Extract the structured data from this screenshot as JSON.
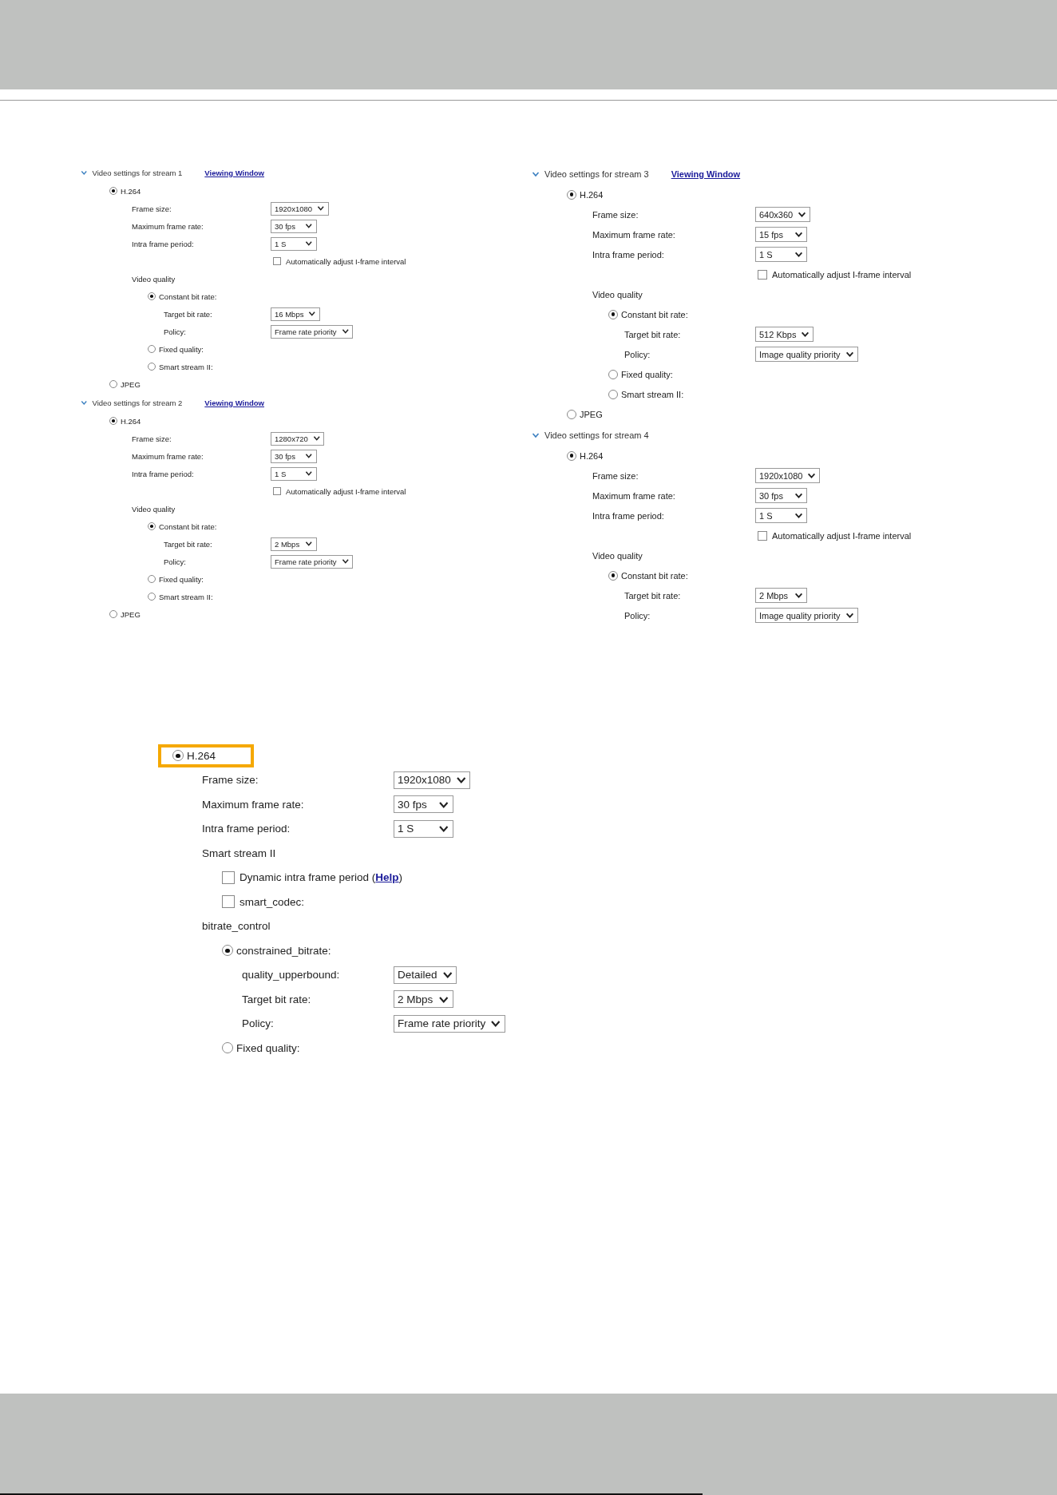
{
  "screenshots": [
    {
      "streams": [
        {
          "title": "Video settings for stream 1",
          "link": "Viewing Window",
          "expanded": true,
          "children": [
            {
              "kind": "radio",
              "label": "H.264",
              "selected": true,
              "children": [
                {
                  "kind": "select",
                  "label": "Frame size:",
                  "value": "1920x1080"
                },
                {
                  "kind": "select",
                  "label": "Maximum frame rate:",
                  "value": "30 fps"
                },
                {
                  "kind": "select",
                  "label": "Intra frame period:",
                  "value": "1 S"
                },
                {
                  "kind": "option",
                  "label": "Automatically adjust I-frame interval",
                  "checked": false
                },
                {
                  "kind": "heading",
                  "label": "Video quality",
                  "children": [
                    {
                      "kind": "radio",
                      "label": "Constant bit rate:",
                      "selected": true,
                      "children": [
                        {
                          "kind": "select",
                          "label": "Target bit rate:",
                          "value": "16 Mbps"
                        },
                        {
                          "kind": "select",
                          "label": "Policy:",
                          "value": "Frame rate priority"
                        }
                      ]
                    },
                    {
                      "kind": "radio",
                      "label": "Fixed quality:",
                      "selected": false
                    },
                    {
                      "kind": "radio",
                      "label": "Smart stream II:",
                      "selected": false
                    }
                  ]
                }
              ]
            },
            {
              "kind": "radio",
              "label": "JPEG",
              "selected": false
            }
          ]
        },
        {
          "title": "Video settings for stream 2",
          "link": "Viewing Window",
          "expanded": true,
          "children": [
            {
              "kind": "radio",
              "label": "H.264",
              "selected": true,
              "children": [
                {
                  "kind": "select",
                  "label": "Frame size:",
                  "value": "1280x720"
                },
                {
                  "kind": "select",
                  "label": "Maximum frame rate:",
                  "value": "30 fps"
                },
                {
                  "kind": "select",
                  "label": "Intra frame period:",
                  "value": "1 S"
                },
                {
                  "kind": "option",
                  "label": "Automatically adjust I-frame interval",
                  "checked": false
                },
                {
                  "kind": "heading",
                  "label": "Video quality",
                  "children": [
                    {
                      "kind": "radio",
                      "label": "Constant bit rate:",
                      "selected": true,
                      "children": [
                        {
                          "kind": "select",
                          "label": "Target bit rate:",
                          "value": "2 Mbps"
                        },
                        {
                          "kind": "select",
                          "label": "Policy:",
                          "value": "Frame rate priority"
                        }
                      ]
                    },
                    {
                      "kind": "radio",
                      "label": "Fixed quality:",
                      "selected": false
                    },
                    {
                      "kind": "radio",
                      "label": "Smart stream II:",
                      "selected": false
                    }
                  ]
                }
              ]
            },
            {
              "kind": "radio",
              "label": "JPEG",
              "selected": false
            }
          ]
        }
      ]
    },
    {
      "streams": [
        {
          "title": "Video settings for stream 3",
          "link": "Viewing Window",
          "expanded": true,
          "children": [
            {
              "kind": "radio",
              "label": "H.264",
              "selected": true,
              "children": [
                {
                  "kind": "select",
                  "label": "Frame size:",
                  "value": "640x360"
                },
                {
                  "kind": "select",
                  "label": "Maximum frame rate:",
                  "value": "15 fps"
                },
                {
                  "kind": "select",
                  "label": "Intra frame period:",
                  "value": "1 S"
                },
                {
                  "kind": "option",
                  "label": "Automatically adjust I-frame interval",
                  "checked": false
                },
                {
                  "kind": "heading",
                  "label": "Video quality",
                  "children": [
                    {
                      "kind": "radio",
                      "label": "Constant bit rate:",
                      "selected": true,
                      "children": [
                        {
                          "kind": "select",
                          "label": "Target bit rate:",
                          "value": "512 Kbps"
                        },
                        {
                          "kind": "select",
                          "label": "Policy:",
                          "value": "Image quality priority"
                        }
                      ]
                    },
                    {
                      "kind": "radio",
                      "label": "Fixed quality:",
                      "selected": false
                    },
                    {
                      "kind": "radio",
                      "label": "Smart stream II:",
                      "selected": false
                    }
                  ]
                }
              ]
            },
            {
              "kind": "radio",
              "label": "JPEG",
              "selected": false
            }
          ]
        },
        {
          "title": "Video settings for stream 4",
          "expanded": true,
          "children": [
            {
              "kind": "radio",
              "label": "H.264",
              "selected": true,
              "children": [
                {
                  "kind": "select",
                  "label": "Frame size:",
                  "value": "1920x1080"
                },
                {
                  "kind": "select",
                  "label": "Maximum frame rate:",
                  "value": "30 fps"
                },
                {
                  "kind": "select",
                  "label": "Intra frame period:",
                  "value": "1 S"
                },
                {
                  "kind": "option",
                  "label": "Automatically adjust I-frame interval",
                  "checked": false
                },
                {
                  "kind": "heading",
                  "label": "Video quality",
                  "children": [
                    {
                      "kind": "radio",
                      "label": "Constant bit rate:",
                      "selected": true,
                      "children": [
                        {
                          "kind": "select",
                          "label": "Target bit rate:",
                          "value": "2 Mbps"
                        },
                        {
                          "kind": "select",
                          "label": "Policy:",
                          "value": "Image quality priority"
                        }
                      ]
                    }
                  ]
                }
              ]
            }
          ]
        }
      ]
    }
  ],
  "detail_panel": {
    "children": [
      {
        "kind": "radio",
        "label": "H.264",
        "selected": true,
        "highlighted": true,
        "children": [
          {
            "kind": "select",
            "label": "Frame size:",
            "value": "1920x1080"
          },
          {
            "kind": "select",
            "label": "Maximum frame rate:",
            "value": "30 fps"
          },
          {
            "kind": "select",
            "label": "Intra frame period:",
            "value": "1 S"
          },
          {
            "kind": "heading",
            "label": "Smart stream II",
            "children": [
              {
                "kind": "checkbox",
                "label": "Dynamic intra frame period (",
                "link": "Help",
                "label_after": ")",
                "checked": false
              },
              {
                "kind": "checkbox",
                "label": "smart_codec:",
                "checked": false
              }
            ]
          },
          {
            "kind": "heading",
            "label": "bitrate_control",
            "children": [
              {
                "kind": "radio",
                "label": "constrained_bitrate:",
                "selected": true,
                "children": [
                  {
                    "kind": "select",
                    "label": "quality_upperbound:",
                    "value": "Detailed"
                  },
                  {
                    "kind": "select",
                    "label": "Target bit rate:",
                    "value": "2 Mbps"
                  },
                  {
                    "kind": "select",
                    "label": "Policy:",
                    "value": "Frame rate priority"
                  }
                ]
              },
              {
                "kind": "radio",
                "label": "Fixed quality:",
                "selected": false
              }
            ]
          }
        ]
      }
    ]
  }
}
